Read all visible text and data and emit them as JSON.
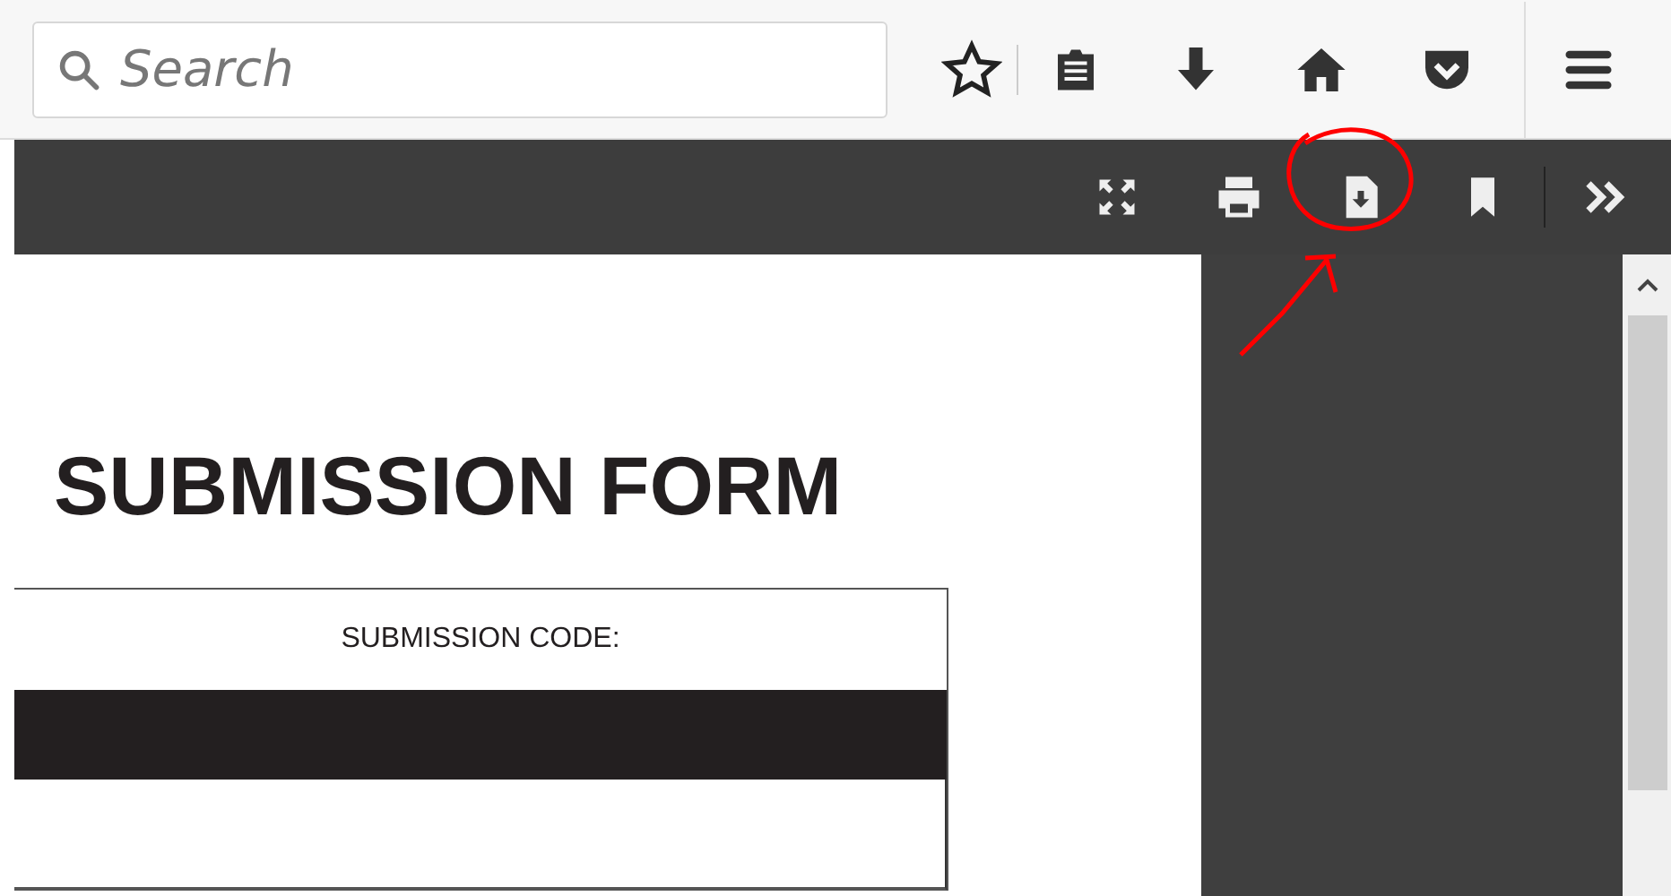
{
  "toolbar": {
    "search": {
      "placeholder": "Search"
    }
  },
  "document": {
    "title": "SUBMISSION FORM",
    "table": {
      "header": "SUBMISSION CODE:"
    }
  }
}
